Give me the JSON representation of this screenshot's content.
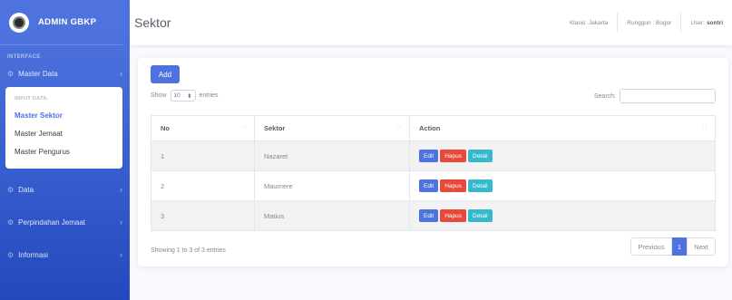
{
  "sidebar": {
    "brand": "ADMIN GBKP",
    "heading": "INTERFACE",
    "items": [
      {
        "label": "Master Data"
      },
      {
        "label": "Data"
      },
      {
        "label": "Perpindahan Jemaat"
      },
      {
        "label": "Informasi"
      }
    ],
    "submenu": {
      "heading": "INPUT DATA:",
      "items": [
        {
          "label": "Master Sektor"
        },
        {
          "label": "Master Jemaat"
        },
        {
          "label": "Master Pengurus"
        }
      ]
    }
  },
  "topbar": {
    "title": "Sektor",
    "klasis": "Klasis: Jakarta",
    "runggun": "Runggun : Bogor",
    "user_label": "User:",
    "user_name": "sontri"
  },
  "toolbar": {
    "add_label": "Add",
    "show_label": "Show",
    "entries_value": "10",
    "entries_label": "entries",
    "search_label": "Search:"
  },
  "table": {
    "headers": [
      "No",
      "Sektor",
      "Action"
    ],
    "rows": [
      {
        "no": "1",
        "sektor": "Nazaret"
      },
      {
        "no": "2",
        "sektor": "Maumere"
      },
      {
        "no": "3",
        "sektor": "Matius"
      }
    ],
    "actions": {
      "edit": "Edit",
      "hapus": "Hapus",
      "detail": "Detail"
    }
  },
  "footer": {
    "info": "Showing 1 to 3 of 3 entries",
    "previous": "Previous",
    "page": "1",
    "next": "Next"
  },
  "colors": {
    "primary": "#4e73df",
    "danger": "#e74a3b",
    "info": "#36b9cc"
  }
}
